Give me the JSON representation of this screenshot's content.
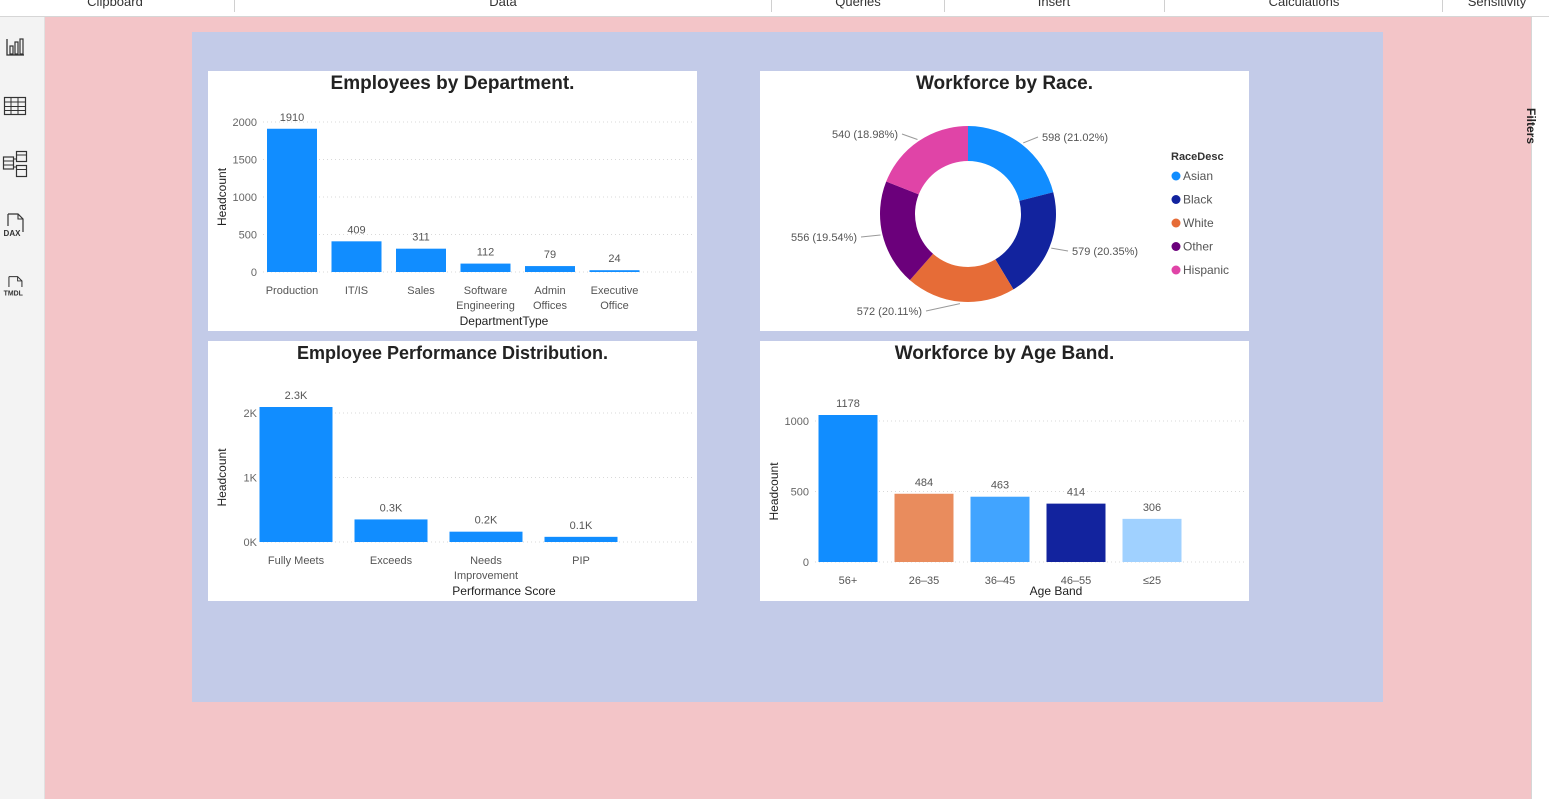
{
  "ribbon": {
    "groups": [
      "Clipboard",
      "Data",
      "Queries",
      "Insert",
      "Calculations",
      "Sensitivity"
    ]
  },
  "left_toolbar": {
    "items": [
      {
        "name": "report-view",
        "icon": "bar-chart-icon"
      },
      {
        "name": "table-view",
        "icon": "table-grid-icon"
      },
      {
        "name": "model-view",
        "icon": "model-diagram-icon"
      },
      {
        "name": "dax-query-view",
        "icon": "dax-icon",
        "label": "DAX"
      },
      {
        "name": "tmdl-view",
        "icon": "tmdl-icon",
        "label": "TMDL"
      }
    ]
  },
  "right_pane": {
    "label": "Filters"
  },
  "colors": {
    "page_background": "#f3c5c8",
    "canvas_background": "#c3cbe8",
    "primary_blue": "#118dff",
    "dark_blue": "#12239e",
    "orange": "#e66c37",
    "purple": "#6b007b",
    "pink": "#e044a7"
  },
  "chart_data": [
    {
      "type": "bar",
      "title": "Employees by Department.",
      "xlabel": "DepartmentType",
      "ylabel": "Headcount",
      "categories": [
        "Production",
        "IT/IS",
        "Sales",
        "Software Engineering",
        "Admin Offices",
        "Executive Office"
      ],
      "values": [
        1910,
        409,
        311,
        112,
        79,
        24
      ],
      "data_labels": [
        "1910",
        "409",
        "311",
        "112",
        "79",
        "24"
      ],
      "yticks": [
        0,
        500,
        1000,
        1500,
        2000
      ],
      "ytick_labels": [
        "0",
        "500",
        "1000",
        "1500",
        "2000"
      ],
      "ylim": [
        0,
        2000
      ],
      "color": "#118dff",
      "grid": true
    },
    {
      "type": "pie",
      "title": "Workforce by Race.",
      "legend_title": "RaceDesc",
      "legend_position": "right",
      "slices": [
        {
          "name": "Asian",
          "value": 598,
          "label": "598 (21.02%)",
          "color": "#118dff"
        },
        {
          "name": "Black",
          "value": 579,
          "label": "579 (20.35%)",
          "color": "#12239e"
        },
        {
          "name": "White",
          "value": 572,
          "label": "572 (20.11%)",
          "color": "#e66c37"
        },
        {
          "name": "Other",
          "value": 556,
          "label": "556 (19.54%)",
          "color": "#6b007b"
        },
        {
          "name": "Hispanic",
          "value": 540,
          "label": "540 (18.98%)",
          "color": "#e044a7"
        }
      ]
    },
    {
      "type": "bar",
      "title": "Employee Performance Distribution.",
      "xlabel": "Performance Score",
      "ylabel": "Headcount",
      "categories": [
        "Fully Meets",
        "Exceeds",
        "Needs Improvement",
        "PIP"
      ],
      "values": [
        2250,
        350,
        160,
        80
      ],
      "data_labels": [
        "2.3K",
        "0.3K",
        "0.2K",
        "0.1K"
      ],
      "yticks": [
        0,
        1000,
        2000
      ],
      "ytick_labels": [
        "0K",
        "1K",
        "2K"
      ],
      "ylim": [
        0,
        2000
      ],
      "color": "#118dff",
      "grid": true
    },
    {
      "type": "bar",
      "title": "Workforce by Age Band.",
      "xlabel": "Age Band",
      "ylabel": "Headcount",
      "categories": [
        "56+",
        "26–35",
        "36–45",
        "46–55",
        "≤25"
      ],
      "values": [
        1178,
        484,
        463,
        414,
        306
      ],
      "data_labels": [
        "1178",
        "484",
        "463",
        "414",
        "306"
      ],
      "colors": [
        "#118dff",
        "#e98c5d",
        "#41a4ff",
        "#12239e",
        "#a0d1ff"
      ],
      "yticks": [
        0,
        500,
        1000
      ],
      "ytick_labels": [
        "0",
        "500",
        "1000"
      ],
      "ylim": [
        0,
        1000
      ],
      "grid": true
    }
  ]
}
